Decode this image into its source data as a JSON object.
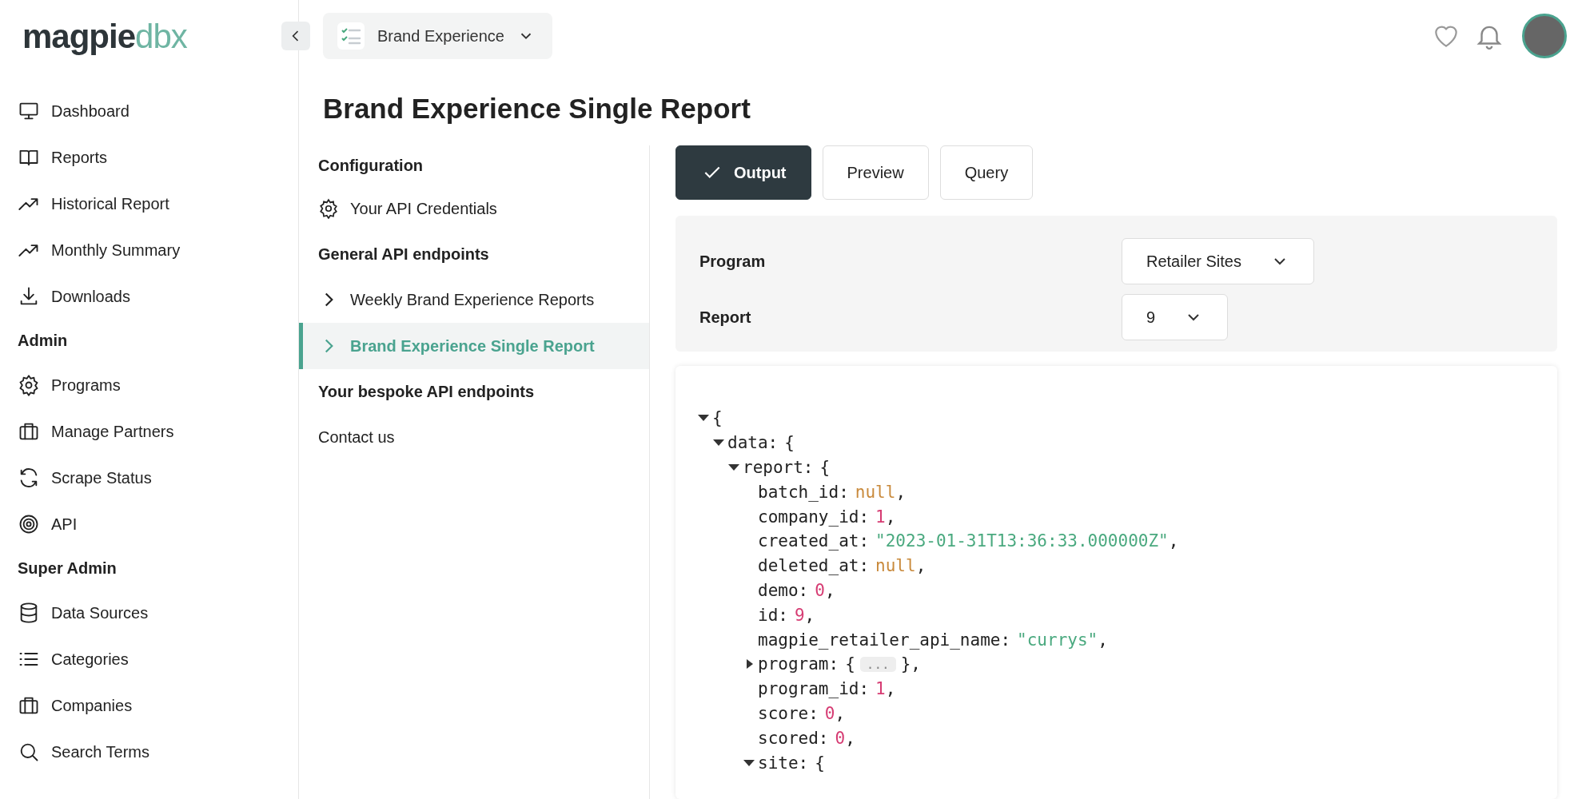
{
  "logo": {
    "text": "magpie",
    "accent": "dbx"
  },
  "sidebar": {
    "items": [
      {
        "kind": "link",
        "label": "Dashboard"
      },
      {
        "kind": "link",
        "label": "Reports"
      },
      {
        "kind": "link",
        "label": "Historical Report"
      },
      {
        "kind": "link",
        "label": "Monthly Summary"
      },
      {
        "kind": "link",
        "label": "Downloads"
      },
      {
        "kind": "heading",
        "label": "Admin"
      },
      {
        "kind": "link",
        "label": "Programs"
      },
      {
        "kind": "link",
        "label": "Manage Partners"
      },
      {
        "kind": "link",
        "label": "Scrape Status"
      },
      {
        "kind": "link",
        "label": "API"
      },
      {
        "kind": "heading",
        "label": "Super Admin"
      },
      {
        "kind": "link",
        "label": "Data Sources"
      },
      {
        "kind": "link",
        "label": "Categories"
      },
      {
        "kind": "link",
        "label": "Companies"
      },
      {
        "kind": "link",
        "label": "Search Terms"
      }
    ]
  },
  "program_switcher": {
    "label": "Brand Experience"
  },
  "page_title": "Brand Experience Single Report",
  "api_nav": {
    "items": [
      {
        "kind": "heading",
        "label": "Configuration"
      },
      {
        "kind": "settings",
        "label": "Your API Credentials",
        "selected": false
      },
      {
        "kind": "heading",
        "label": "General API endpoints"
      },
      {
        "kind": "expandable",
        "label": "Weekly Brand Experience Reports",
        "selected": false
      },
      {
        "kind": "expandable",
        "label": "Brand Experience Single Report",
        "selected": true
      },
      {
        "kind": "heading",
        "label": "Your bespoke API endpoints"
      },
      {
        "kind": "link",
        "label": "Contact us",
        "selected": false
      }
    ]
  },
  "tabs": [
    {
      "label": "Output",
      "selected": true
    },
    {
      "label": "Preview",
      "selected": false
    },
    {
      "label": "Query",
      "selected": false
    }
  ],
  "form": {
    "fields": [
      {
        "label": "Program",
        "value": "Retailer Sites"
      },
      {
        "label": "Report",
        "value": "9"
      }
    ]
  },
  "json_viewer": {
    "root": {
      "kind": "object",
      "expanded": true,
      "open": "{",
      "children": [
        {
          "key": "data:",
          "kind": "object",
          "expanded": true,
          "open": "{",
          "children": [
            {
              "key": "report:",
              "kind": "object",
              "expanded": true,
              "open": "{",
              "children": [
                {
                  "key": "batch_id:",
                  "kind": "null",
                  "value": "null",
                  "suffix": ","
                },
                {
                  "key": "company_id:",
                  "kind": "number",
                  "value": "1",
                  "suffix": ","
                },
                {
                  "key": "created_at:",
                  "kind": "string",
                  "value": "\"2023-01-31T13:36:33.000000Z\"",
                  "suffix": ","
                },
                {
                  "key": "deleted_at:",
                  "kind": "null",
                  "value": "null",
                  "suffix": ","
                },
                {
                  "key": "demo:",
                  "kind": "number",
                  "value": "0",
                  "suffix": ","
                },
                {
                  "key": "id:",
                  "kind": "number",
                  "value": "9",
                  "suffix": ","
                },
                {
                  "key": "magpie_retailer_api_name:",
                  "kind": "string",
                  "value": "\"currys\"",
                  "suffix": ","
                },
                {
                  "key": "program:",
                  "kind": "object",
                  "expanded": false,
                  "open": "{",
                  "placeholder": "...",
                  "close": "},"
                },
                {
                  "key": "program_id:",
                  "kind": "number",
                  "value": "1",
                  "suffix": ","
                },
                {
                  "key": "score:",
                  "kind": "number",
                  "value": "0",
                  "suffix": ","
                },
                {
                  "key": "scored:",
                  "kind": "number",
                  "value": "0",
                  "suffix": ","
                },
                {
                  "key": "site:",
                  "kind": "object",
                  "expanded": true,
                  "open": "{"
                }
              ]
            }
          ]
        }
      ]
    }
  }
}
